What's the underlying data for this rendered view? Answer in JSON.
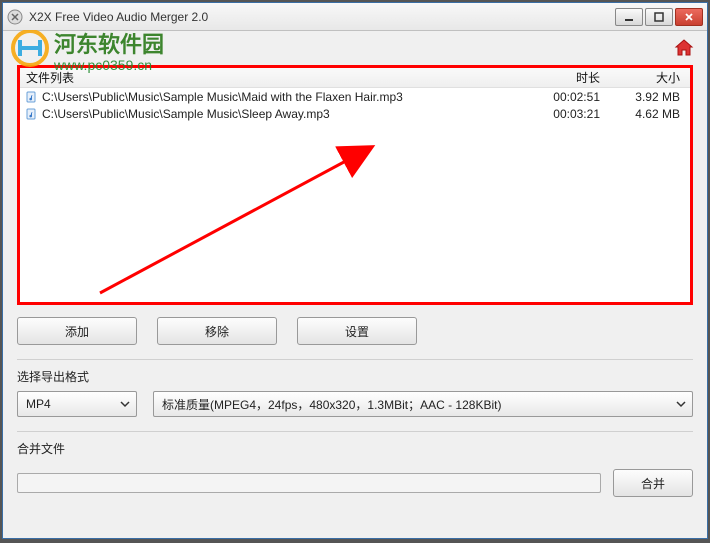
{
  "window": {
    "title": "X2X Free Video Audio Merger 2.0"
  },
  "list": {
    "headers": {
      "file": "文件列表",
      "duration": "时长",
      "size": "大小"
    },
    "rows": [
      {
        "path": "C:\\Users\\Public\\Music\\Sample Music\\Maid with the Flaxen Hair.mp3",
        "duration": "00:02:51",
        "size": "3.92 MB"
      },
      {
        "path": "C:\\Users\\Public\\Music\\Sample Music\\Sleep Away.mp3",
        "duration": "00:03:21",
        "size": "4.62 MB"
      }
    ]
  },
  "buttons": {
    "add": "添加",
    "remove": "移除",
    "settings": "设置",
    "merge": "合并"
  },
  "format": {
    "label": "选择导出格式",
    "container": "MP4",
    "quality": "标准质量(MPEG4，24fps，480x320，1.3MBit；AAC - 128KBit)"
  },
  "merge": {
    "label": "合并文件"
  },
  "watermark": {
    "brand": "河东软件园",
    "url": "www.pc0359.cn"
  }
}
